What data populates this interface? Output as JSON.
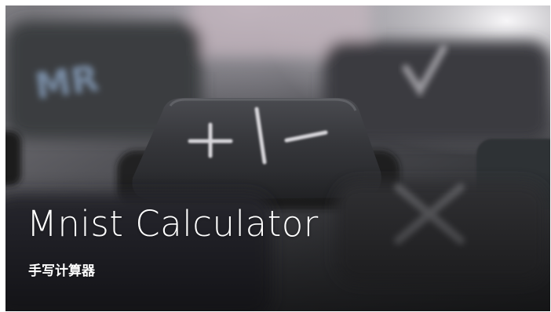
{
  "hero": {
    "title": "Mnist Calculator",
    "subtitle": "手写计算器"
  },
  "image": {
    "description_icon": "calculator-keys-photo"
  },
  "colors": {
    "text": "#ffffff",
    "key_face": "#2f3034",
    "background_dark": "#1c1d20",
    "background_light": "#e9e6ea"
  }
}
